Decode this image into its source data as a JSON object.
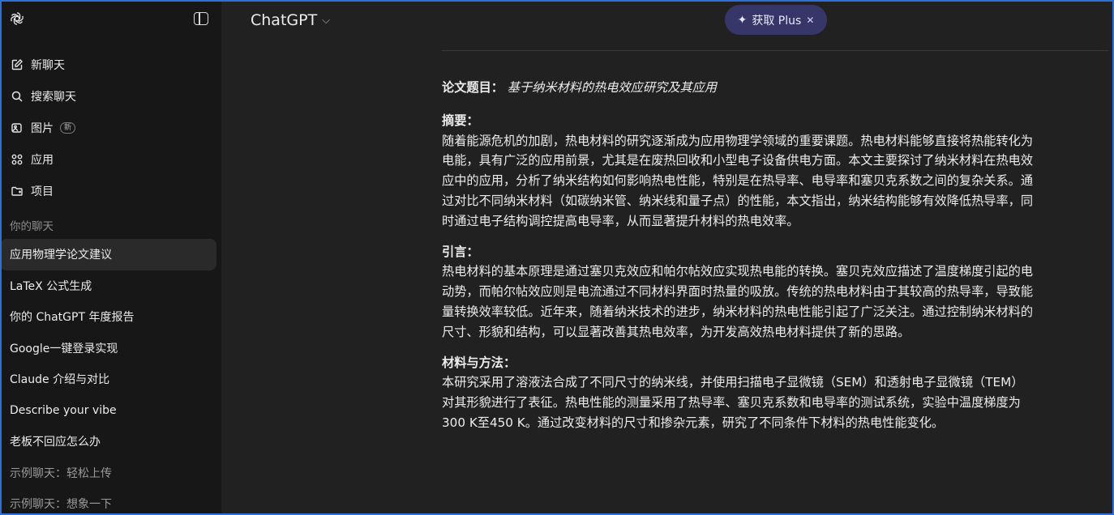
{
  "sidebar": {
    "nav": [
      {
        "label": "新聊天",
        "icon": "edit-icon"
      },
      {
        "label": "搜索聊天",
        "icon": "search-icon"
      },
      {
        "label": "图片",
        "icon": "image-icon",
        "badge": "新"
      },
      {
        "label": "应用",
        "icon": "apps-icon"
      },
      {
        "label": "项目",
        "icon": "folder-icon"
      }
    ],
    "section_title": "你的聊天",
    "chats": [
      "应用物理学论文建议",
      "LaTeX 公式生成",
      "你的 ChatGPT 年度报告",
      "Google一键登录实现",
      "Claude 介绍与对比",
      "Describe your vibe",
      "老板不回应怎么办",
      "示例聊天：轻松上传",
      "示例聊天：想象一下"
    ]
  },
  "header": {
    "model": "ChatGPT",
    "plus_button": "获取 Plus"
  },
  "content": {
    "title_label": "论文题目：",
    "title_value": "基于纳米材料的热电效应研究及其应用",
    "sections": [
      {
        "heading": "摘要：",
        "lines": [
          "随着能源危机的加剧，热电材料的研究逐渐成为应用物理学领域的重要课题。热电材料能够直接将热能转化为",
          "电能，具有广泛的应用前景，尤其是在废热回收和小型电子设备供电方面。本文主要探讨了纳米材料在热电效",
          "应中的应用，分析了纳米结构如何影响热电性能，特别是在热导率、电导率和塞贝克系数之间的复杂关系。通",
          "过对比不同纳米材料（如碳纳米管、纳米线和量子点）的性能，本文指出，纳米结构能够有效降低热导率，同",
          "时通过电子结构调控提高电导率，从而显著提升材料的热电效率。"
        ]
      },
      {
        "heading": "引言：",
        "lines": [
          "热电材料的基本原理是通过塞贝克效应和帕尔帖效应实现热电能的转换。塞贝克效应描述了温度梯度引起的电",
          "动势，而帕尔帖效应则是电流通过不同材料界面时热量的吸放。传统的热电材料由于其较高的热导率，导致能",
          "量转换效率较低。近年来，随着纳米技术的进步，纳米材料的热电性能引起了广泛关注。通过控制纳米材料的",
          "尺寸、形貌和结构，可以显著改善其热电效率，为开发高效热电材料提供了新的思路。"
        ]
      },
      {
        "heading": "材料与方法：",
        "lines": [
          "本研究采用了溶液法合成了不同尺寸的纳米线，并使用扫描电子显微镜（SEM）和透射电子显微镜（TEM）",
          "对其形貌进行了表征。热电性能的测量采用了热导率、塞贝克系数和电导率的测试系统，实验中温度梯度为",
          "300 K至450 K。通过改变材料的尺寸和掺杂元素，研究了不同条件下材料的热电性能变化。"
        ]
      }
    ]
  }
}
